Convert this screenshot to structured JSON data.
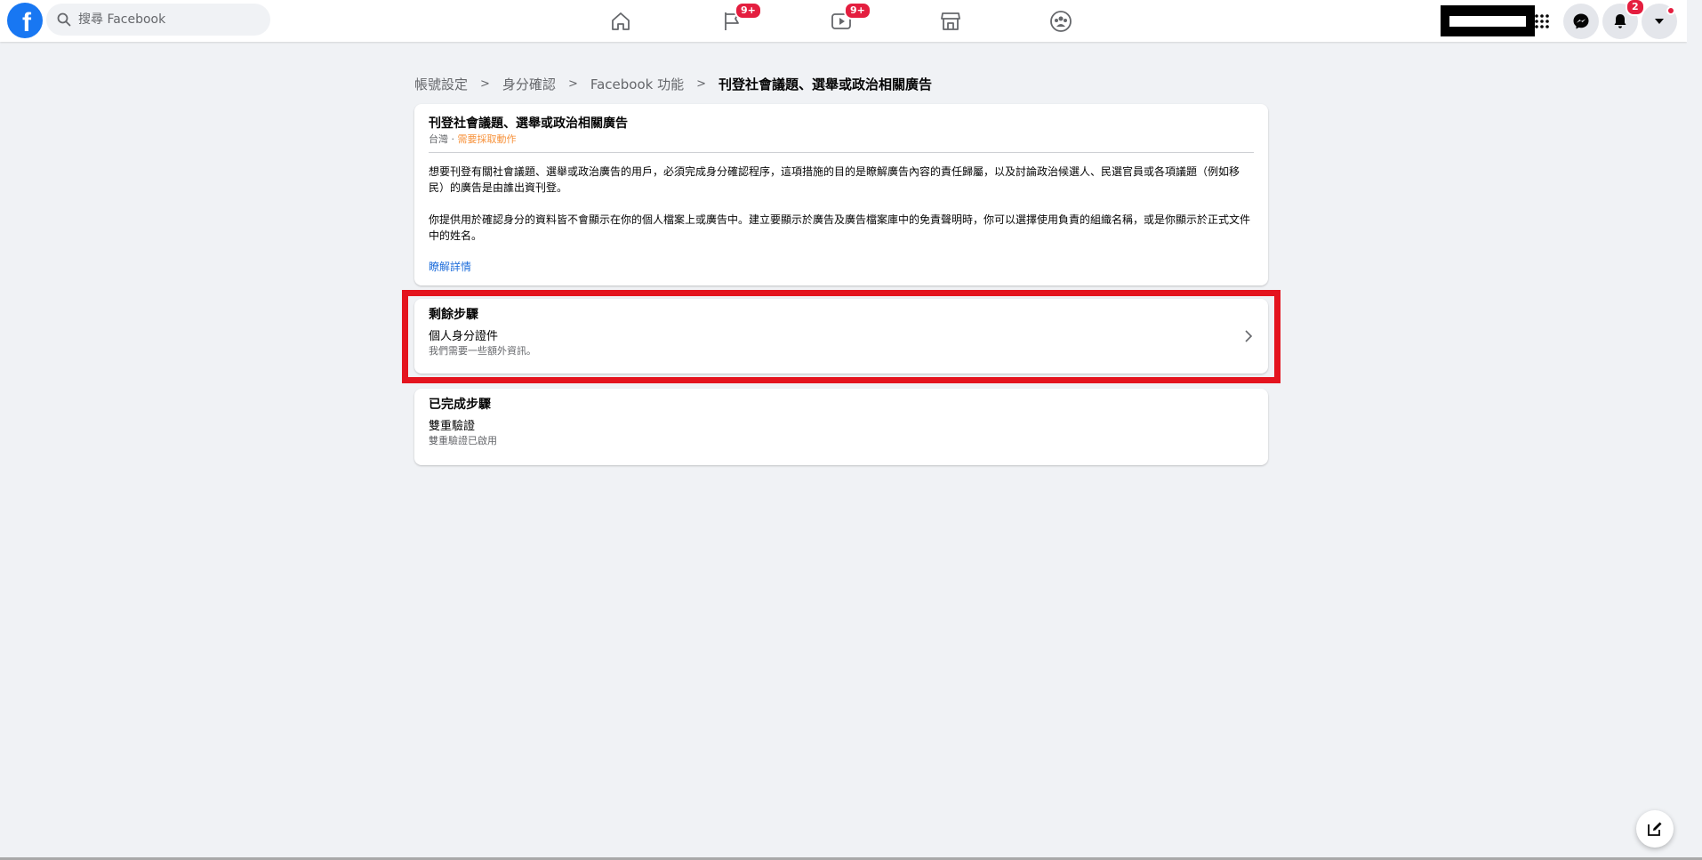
{
  "search": {
    "placeholder": "搜尋 Facebook"
  },
  "nav": {
    "flag_badge": "9+",
    "video_badge": "9+",
    "notifications_badge": "2"
  },
  "breadcrumb": {
    "items": [
      "帳號設定",
      "身分確認",
      "Facebook 功能"
    ],
    "current": "刊登社會議題、選舉或政治相關廣告"
  },
  "info_card": {
    "title": "刊登社會議題、選舉或政治相關廣告",
    "region": "台灣 · ",
    "status": "需要採取動作",
    "paragraph1": "想要刊登有關社會議題、選舉或政治廣告的用戶，必須完成身分確認程序，這項措施的目的是瞭解廣告內容的責任歸屬，以及討論政治候選人、民選官員或各項議題（例如移民）的廣告是由誰出資刊登。",
    "paragraph2": "你提供用於確認身分的資料皆不會顯示在你的個人檔案上或廣告中。建立要顯示於廣告及廣告檔案庫中的免責聲明時，你可以選擇使用負責的組織名稱，或是你顯示於正式文件中的姓名。",
    "learn_more": "瞭解詳情"
  },
  "remaining_steps": {
    "heading": "剩餘步驟",
    "item_title": "個人身分證件",
    "item_desc": "我們需要一些額外資訊。"
  },
  "completed_steps": {
    "heading": "已完成步驟",
    "item_title": "雙重驗證",
    "item_desc": "雙重驗證已啟用"
  },
  "colors": {
    "brand": "#1877f2",
    "badge": "#e41e3f",
    "warning": "#f7923b",
    "highlight_box": "#e4141e",
    "link": "#216fdb"
  }
}
